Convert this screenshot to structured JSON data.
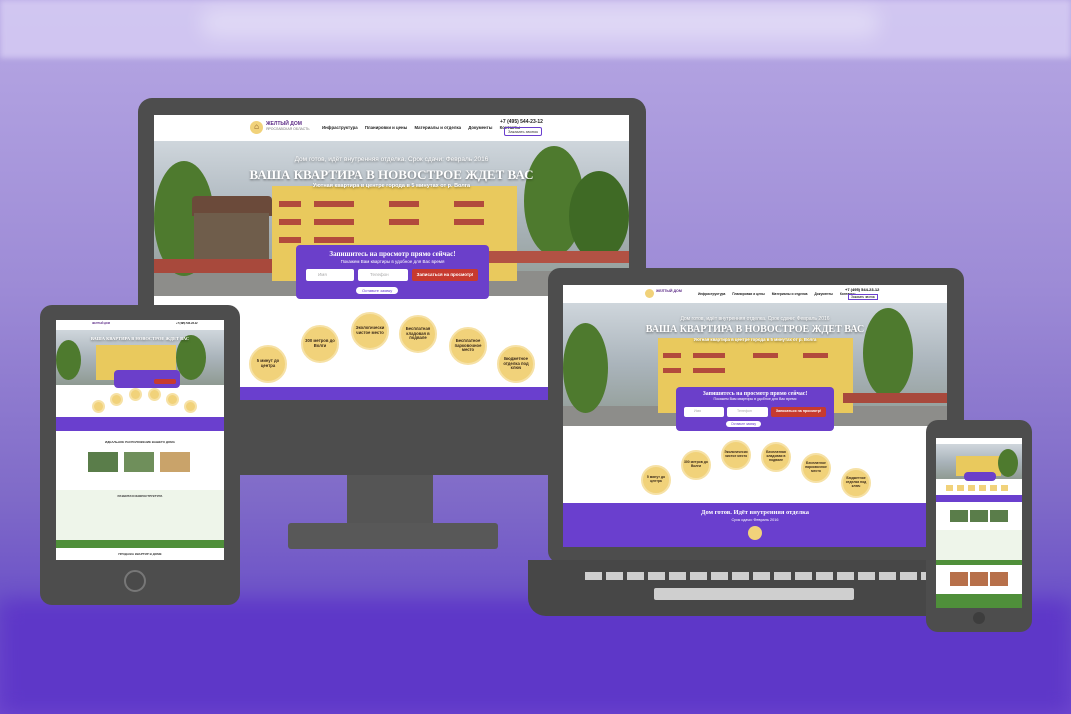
{
  "site": {
    "logo_title": "ЖЕЛТЫЙ ДОМ",
    "logo_subtitle": "ЯРОСЛАВСКАЯ ОБЛАСТЬ",
    "nav": [
      "Инфраструктура",
      "Планировки и цены",
      "Материалы и отделка",
      "Документы",
      "Контакты"
    ],
    "phone": "+7 (495) 544-23-12",
    "callback_button": "Заказать звонок",
    "hero_status": "Дом готов, идёт внутренняя отделка. Срок сдачи: Февраль 2016",
    "hero_status_short": "Дом готов. Идёт внутренняя отделка",
    "hero_title": "ВАША КВАРТИРА В НОВОСТРОЕ ЖДЕТ ВАС",
    "hero_subtitle": "Уютная квартира в центре города в 5 минутах от р. Волга",
    "form_title": "Запишитесь на просмотр прямо сейчас!",
    "form_subtitle": "Покажем Вам квартиры в удобное для Вас время",
    "name_placeholder": "Имя",
    "phone_placeholder": "Телефон",
    "form_button": "Записаться на просмотр!",
    "form_note": "Оставьте заявку",
    "deadline": "Срок сдачи: Февраль 2016",
    "features": [
      "5 минут до центра",
      "300 метров до Волги",
      "Экологически чистое место",
      "Бесплатная кладовая в подвале",
      "Бесплатное парковочное место",
      "Бюджетное отделка под ключ"
    ],
    "section_location": "ИДЕАЛЬНОЕ РАСПОЛОЖЕНИЕ ВАШЕГО ДОМА",
    "section_infrastructure": "РАЗВИТАЯ ИНФРАСТРУКТУРА",
    "section_sales": "ПРОДАЖА КВАРТИР В ДОМЕ"
  },
  "colors": {
    "accent": "#6a3fce",
    "button": "#c73a2f",
    "feature": "#f1d27a",
    "device": "#4d4d4d"
  }
}
